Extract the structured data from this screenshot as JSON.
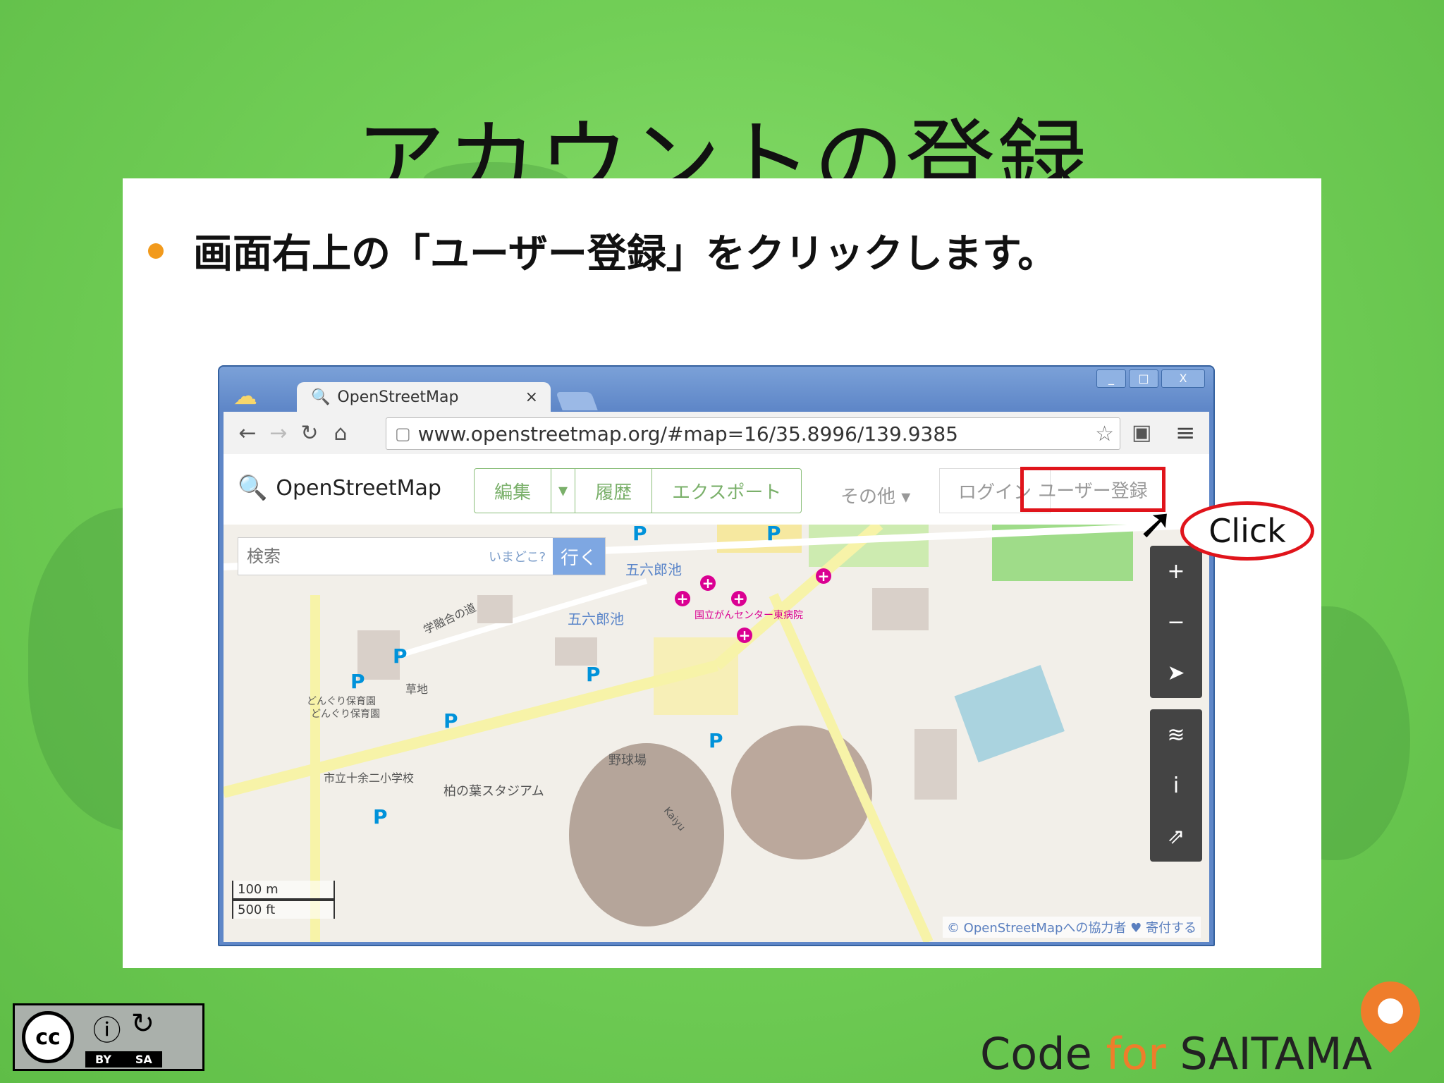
{
  "slide": {
    "title": "アカウントの登録",
    "bullet": "画面右上の「ユーザー登録」をクリックします。"
  },
  "browser": {
    "tab_title": "OpenStreetMap",
    "tab_close": "×",
    "url": "www.openstreetmap.org/#map=16/35.8996/139.9385",
    "window_controls": [
      "_",
      "□",
      "X"
    ]
  },
  "osm": {
    "logo_text": "OpenStreetMap",
    "nav": {
      "edit": "編集",
      "edit_dropdown": "▾",
      "history": "履歴",
      "export": "エクスポート",
      "other": "その他 ▾",
      "login": "ログイン",
      "signup": "ユーザー登録"
    },
    "search": {
      "placeholder": "検索",
      "where_am_i": "いまどこ?",
      "go": "行く"
    },
    "map_labels": {
      "pond1": "五六郎池",
      "pond2": "五六郎池",
      "hospital": "国立がんセンター東病院",
      "road": "学融合の道",
      "meadow": "草地",
      "nursery1": "どんぐり保育園",
      "nursery2": "どんぐり保育園",
      "school": "市立十余二小学校",
      "stadium": "柏の葉スタジアム",
      "baseball": "野球場",
      "road2": "Kaiyu"
    },
    "scale": {
      "metric": "100 m",
      "imperial": "500 ft"
    },
    "attribution": "© OpenStreetMapへの協力者 ♥ 寄付する",
    "controls": [
      "+",
      "−",
      "➤",
      "≋",
      "i",
      "⇗"
    ]
  },
  "callout": {
    "text": "Click"
  },
  "license": {
    "cc": "cc",
    "by": "BY",
    "sa": "SA"
  },
  "footer_logo": {
    "code": "Code ",
    "for": "for",
    "saitama": " SAITAMA"
  }
}
